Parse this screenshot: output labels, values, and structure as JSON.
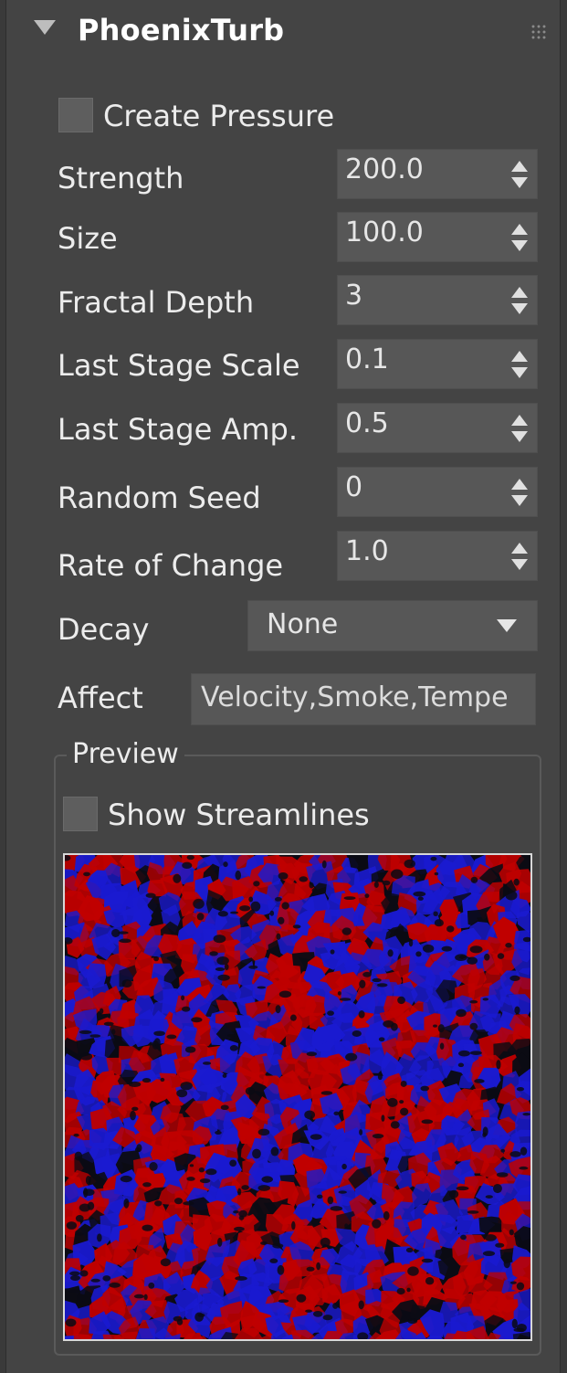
{
  "rollout": {
    "title": "PhoenixTurb"
  },
  "create_pressure": {
    "label": "Create Pressure",
    "checked": false
  },
  "params": [
    {
      "label": "Strength",
      "value": "200.0"
    },
    {
      "label": "Size",
      "value": "100.0"
    },
    {
      "label": "Fractal Depth",
      "value": "3"
    },
    {
      "label": "Last Stage Scale",
      "value": "0.1"
    },
    {
      "label": "Last Stage Amp.",
      "value": "0.5"
    },
    {
      "label": "Random Seed",
      "value": "0"
    },
    {
      "label": "Rate of Change",
      "value": "1.0"
    }
  ],
  "decay": {
    "label": "Decay",
    "value": "None"
  },
  "affect": {
    "label": "Affect",
    "value": "Velocity,Smoke,Tempe"
  },
  "preview": {
    "title": "Preview",
    "show_streamlines": {
      "label": "Show Streamlines",
      "checked": false
    },
    "colors": {
      "red": "#c00000",
      "blue": "#1a1ad0",
      "dark": "#0b0b14"
    }
  }
}
